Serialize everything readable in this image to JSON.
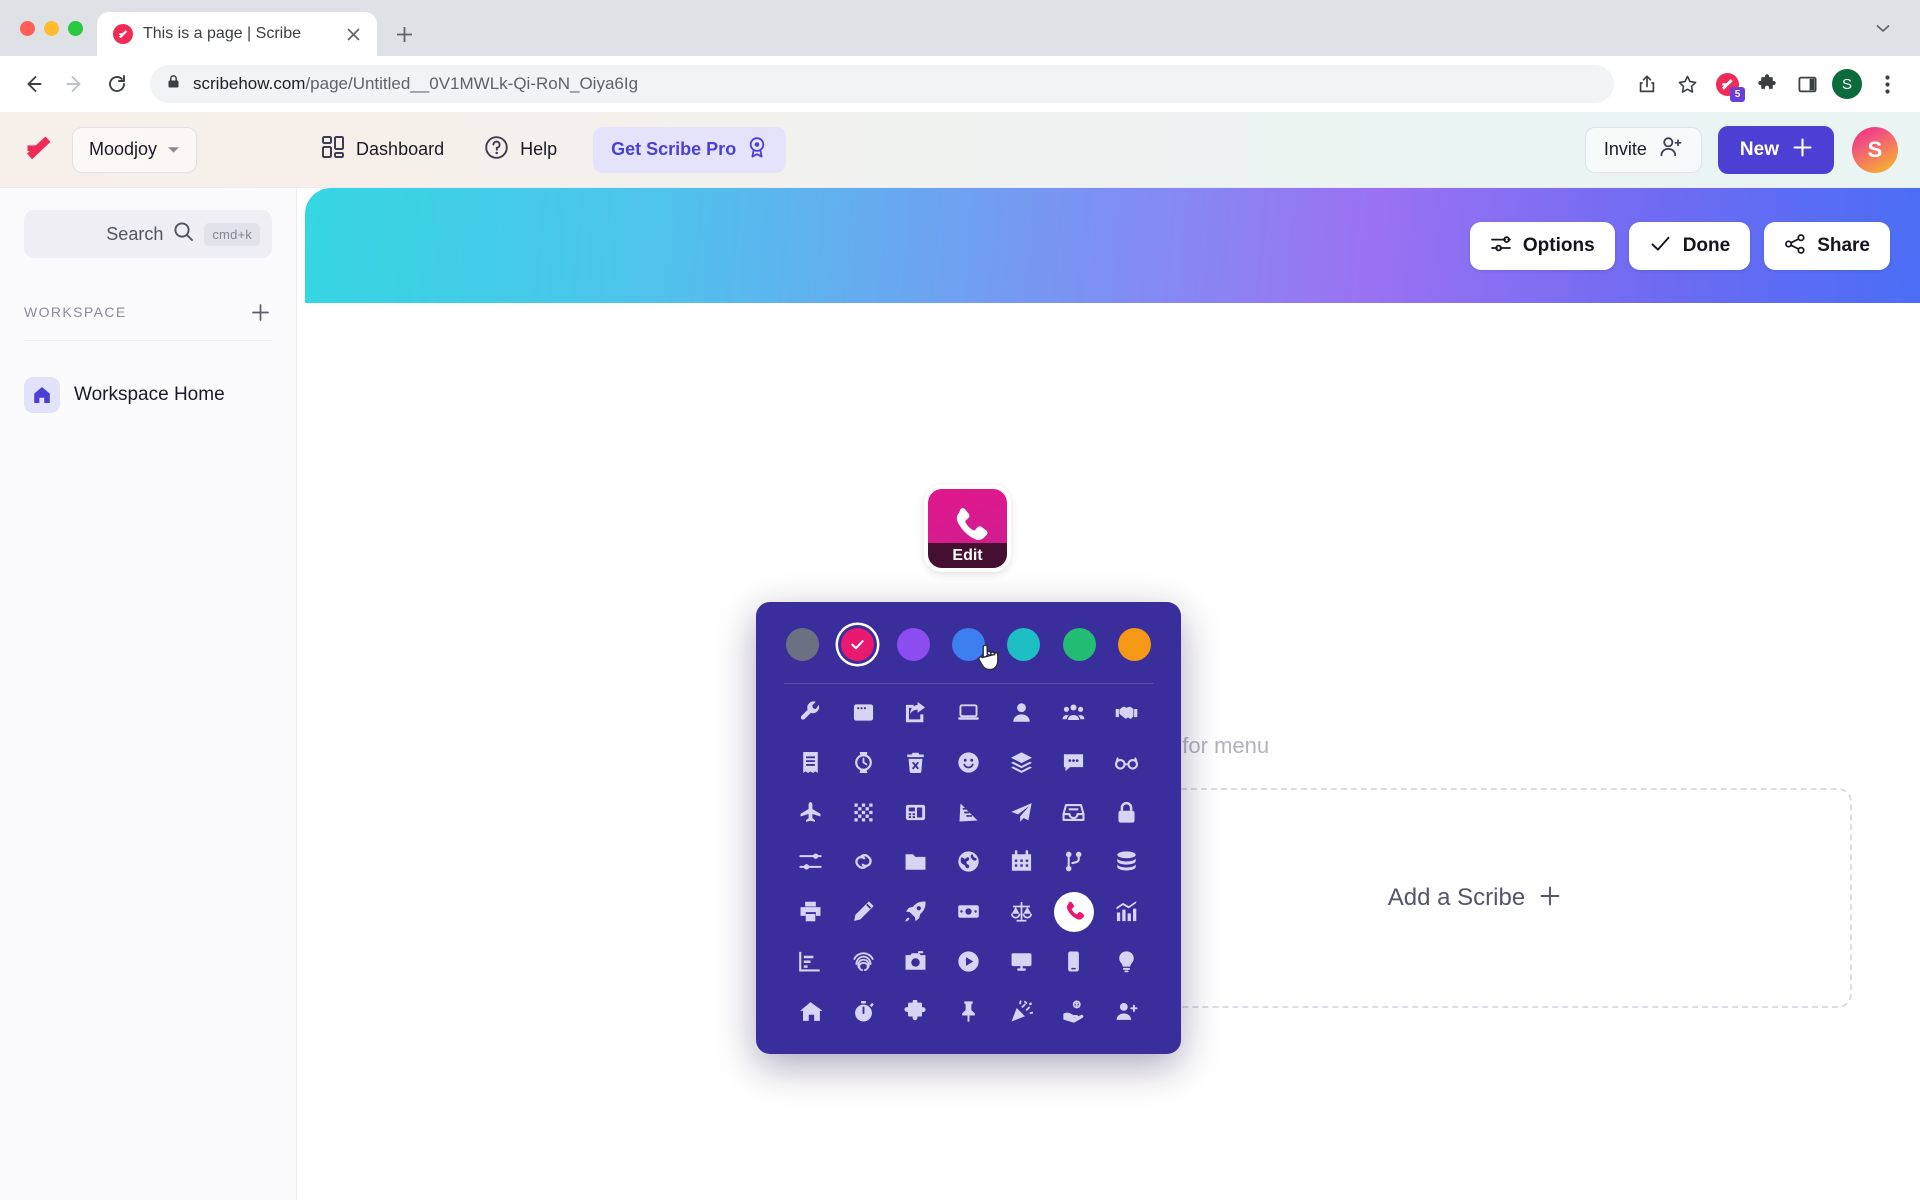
{
  "browser": {
    "tab": {
      "title": "This is a page | Scribe",
      "favicon": "scribe-favicon"
    },
    "new_tab_label": "+",
    "url_domain": "scribehow.com",
    "url_path": "/page/Untitled__0V1MWLk-Qi-RoN_Oiya6Ig",
    "extension_badge_count": "5",
    "profile_initial": "S",
    "icons": [
      "back-icon",
      "forward-icon",
      "reload-icon",
      "lock-icon",
      "share-icon",
      "bookmark-star-icon",
      "scribe-extension-icon",
      "extensions-puzzle-icon",
      "side-panel-icon",
      "profile-avatar",
      "browser-menu-icon"
    ]
  },
  "header": {
    "logo": "scribe-logo",
    "workspace_name": "Moodjoy",
    "nav": [
      {
        "label": "Dashboard",
        "icon": "dashboard-icon"
      },
      {
        "label": "Help",
        "icon": "help-circle-icon"
      }
    ],
    "pro_label": "Get Scribe Pro",
    "pro_icon": "award-ribbon-icon",
    "invite_label": "Invite",
    "invite_icon": "user-plus-icon",
    "new_label": "New",
    "new_icon": "plus-icon",
    "avatar_initial": "S",
    "accent_purple": "#4b3fd4",
    "pro_pill_bg": "#e4e3fb"
  },
  "sidebar": {
    "search": {
      "label": "Search",
      "shortcut": "cmd+k",
      "icon": "search-icon"
    },
    "section_title": "WORKSPACE",
    "add_icon": "plus-icon",
    "items": [
      {
        "label": "Workspace Home",
        "icon": "home-icon"
      }
    ]
  },
  "main": {
    "banner_gradient": [
      "#35d6e2",
      "#9b72f2",
      "#4a6ef5"
    ],
    "actions": [
      {
        "label": "Options",
        "icon": "sliders-icon"
      },
      {
        "label": "Done",
        "icon": "check-icon"
      },
      {
        "label": "Share",
        "icon": "share-nodes-icon"
      }
    ],
    "page_icon": {
      "glyph": "phone-icon",
      "color": "#d81b8e",
      "edit_label": "Edit"
    },
    "editor_placeholder": "ontent, type / for menu",
    "add_scribe": {
      "label": "Add a Scribe",
      "icon": "plus-icon"
    }
  },
  "icon_picker": {
    "panel_bg": "#3a2d9c",
    "selected_color": "#e8196e",
    "selected_icon": "phone-icon",
    "colors": [
      {
        "name": "gray",
        "hex": "#6b7183",
        "selected": false
      },
      {
        "name": "pink",
        "hex": "#e8196e",
        "selected": true
      },
      {
        "name": "purple",
        "hex": "#8b4df0",
        "selected": false
      },
      {
        "name": "blue",
        "hex": "#3d7ef0",
        "selected": false
      },
      {
        "name": "teal",
        "hex": "#1ebfc4",
        "selected": false
      },
      {
        "name": "green",
        "hex": "#22bd72",
        "selected": false
      },
      {
        "name": "orange",
        "hex": "#f59815",
        "selected": false
      }
    ],
    "icons": [
      "wrench-icon",
      "browser-window-icon",
      "share-square-icon",
      "laptop-icon",
      "user-icon",
      "users-icon",
      "handshake-icon",
      "receipt-icon",
      "watch-icon",
      "trash-icon",
      "smiley-icon",
      "layers-icon",
      "comment-icon",
      "glasses-icon",
      "plane-icon",
      "keypad-grid-icon",
      "calculator-icon",
      "ruler-triangle-icon",
      "paper-plane-icon",
      "inbox-icon",
      "lock-icon",
      "sliders-icon",
      "link-icon",
      "folder-icon",
      "globe-icon",
      "calendar-icon",
      "git-branch-icon",
      "database-icon",
      "printer-icon",
      "pencil-icon",
      "rocket-icon",
      "money-bill-icon",
      "scales-icon",
      "phone-icon",
      "chart-up-icon",
      "chart-down-icon",
      "fingerprint-icon",
      "camera-icon",
      "play-circle-icon",
      "monitor-icon",
      "mobile-icon",
      "lightbulb-icon",
      "home-icon",
      "stopwatch-icon",
      "puzzle-icon",
      "pin-icon",
      "confetti-icon",
      "hand-dollar-icon",
      "user-plus-icon"
    ]
  },
  "cursor": {
    "type": "pointing-hand",
    "over": "blue-color-swatch"
  }
}
